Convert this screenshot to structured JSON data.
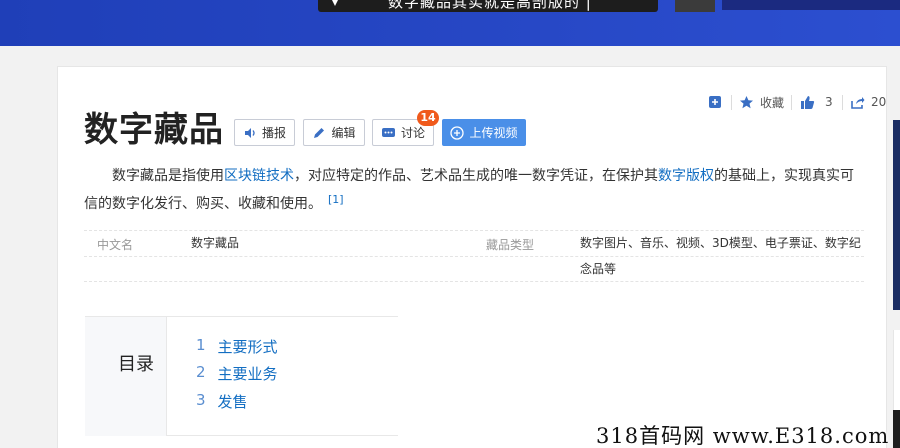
{
  "banner": {
    "video_title": "数字藏品其实就是高剖版的 | "
  },
  "header": {
    "title": "数字藏品",
    "buttons": {
      "bobao": "播报",
      "bianji": "编辑",
      "taolun": "讨论",
      "upload": "上传视频"
    },
    "discuss_badge": "14"
  },
  "actions": {
    "collect_label": "收藏",
    "like_count": "3",
    "share_count": "20"
  },
  "summary": {
    "part1": "数字藏品是指使用",
    "link1": "区块链技术",
    "part2": "，对应特定的作品、艺术品生成的唯一数字凭证，在保护其",
    "link2": "数字版权",
    "part3": "的基础上，实现真实可信的数字化发行、购买、收藏和使用。",
    "ref": "[1]"
  },
  "info": {
    "left_key": "中文名",
    "left_value": "数字藏品",
    "right_key": "藏品类型",
    "right_value": "数字图片、音乐、视频、3D模型、电子票证、数字纪念品等"
  },
  "toc": {
    "title": "目录",
    "items": [
      {
        "num": "1",
        "label": "主要形式"
      },
      {
        "num": "2",
        "label": "主要业务"
      },
      {
        "num": "3",
        "label": "发售"
      }
    ]
  },
  "watermark": "318首码网  www.E318.com",
  "colors": {
    "banner": "#2748c6",
    "link": "#136ec2",
    "upload_button": "#4a8fe8",
    "badge": "#f05a1c"
  }
}
